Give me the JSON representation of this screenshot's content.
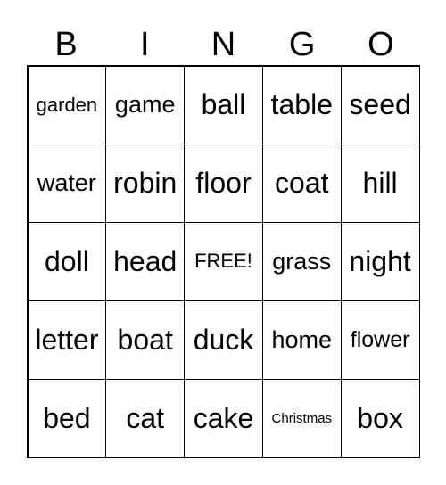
{
  "header": [
    "B",
    "I",
    "N",
    "G",
    "O"
  ],
  "cells": [
    [
      "garden",
      "game",
      "ball",
      "table",
      "seed"
    ],
    [
      "water",
      "robin",
      "floor",
      "coat",
      "hill"
    ],
    [
      "doll",
      "head",
      "FREE!",
      "grass",
      "night"
    ],
    [
      "letter",
      "boat",
      "duck",
      "home",
      "flower"
    ],
    [
      "bed",
      "cat",
      "cake",
      "Christmas",
      "box"
    ]
  ]
}
